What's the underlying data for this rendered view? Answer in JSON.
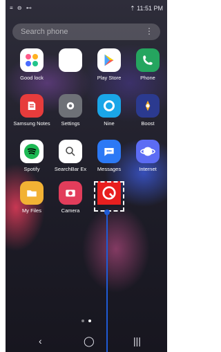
{
  "status_bar": {
    "left_icons": "≡ ⊖ ⊷",
    "right_text": "⇡ 11:51 PM"
  },
  "search": {
    "placeholder": "Search phone",
    "more_icon": "⋮"
  },
  "apps": [
    {
      "label": "Good lock",
      "icon": "good-lock-icon",
      "color": "#ffffff"
    },
    {
      "label": "",
      "icon": "blank-app-icon",
      "color": "#ffffff"
    },
    {
      "label": "Play Store",
      "icon": "play-store-icon",
      "color": "#ffffff"
    },
    {
      "label": "Phone",
      "icon": "phone-icon",
      "color": "#25a55f"
    },
    {
      "label": "Samsung Notes",
      "icon": "samsung-notes-icon",
      "color": "#e73c3c"
    },
    {
      "label": "Settings",
      "icon": "settings-icon",
      "color": "#6e7177"
    },
    {
      "label": "Nine",
      "icon": "nine-icon",
      "color": "#1aa6e8"
    },
    {
      "label": "Boost",
      "icon": "boost-icon",
      "color": "#2b3a8f"
    },
    {
      "label": "Spotify",
      "icon": "spotify-icon",
      "color": "#ffffff"
    },
    {
      "label": "SearchBar Ex",
      "icon": "searchbar-icon",
      "color": "#ffffff"
    },
    {
      "label": "Messages",
      "icon": "messages-icon",
      "color": "#2c79f5"
    },
    {
      "label": "Internet",
      "icon": "internet-icon",
      "color": "#5c6cf4"
    },
    {
      "label": "My Files",
      "icon": "my-files-icon",
      "color": "#f2b234"
    },
    {
      "label": "Camera",
      "icon": "camera-icon",
      "color": "#e23d5b"
    },
    {
      "label": "",
      "icon": "red-app-icon",
      "color": "#e81f1f"
    }
  ],
  "pagination": {
    "pages": 2,
    "active": 2
  },
  "nav": {
    "back": "‹",
    "home": "◯",
    "recents": "|||"
  }
}
